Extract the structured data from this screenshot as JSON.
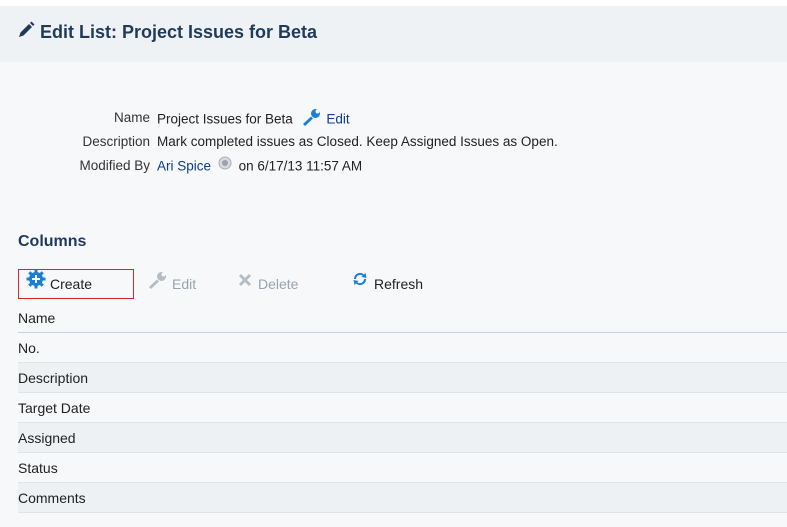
{
  "header": {
    "title": "Edit List: Project Issues for Beta",
    "icon": "pencil-icon"
  },
  "details": {
    "name_label": "Name",
    "name_value": "Project Issues for Beta",
    "name_edit_label": "Edit",
    "description_label": "Description",
    "description_value": "Mark completed issues as Closed. Keep Assigned Issues as Open.",
    "modified_by_label": "Modified By",
    "modified_by_user": "Ari Spice",
    "modified_on": "on 6/17/13 11:57 AM"
  },
  "columns_section": {
    "title": "Columns",
    "toolbar": {
      "create_label": "Create",
      "edit_label": "Edit",
      "delete_label": "Delete",
      "refresh_label": "Refresh"
    },
    "table": {
      "header": "Name",
      "rows": [
        "No.",
        "Description",
        "Target Date",
        "Assigned",
        "Status",
        "Comments"
      ]
    }
  },
  "colors": {
    "accent": "#1f3a5a",
    "link": "#0b3d91",
    "highlight_border": "#d9232e",
    "icon_blue": "#1b7ed6"
  }
}
